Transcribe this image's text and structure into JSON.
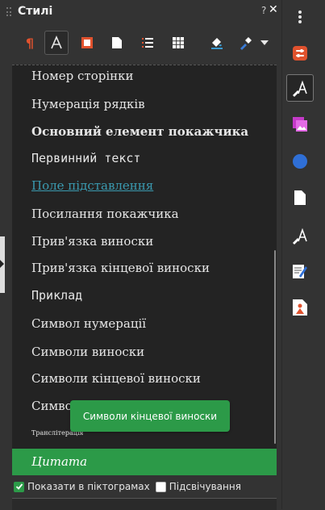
{
  "panel": {
    "title": "Стилі",
    "help_label": "?",
    "close_label": "✕"
  },
  "toolbar": {
    "buttons": [
      {
        "icon": "paragraph-styles-icon"
      },
      {
        "icon": "character-styles-icon",
        "active": true
      },
      {
        "icon": "frame-styles-icon"
      },
      {
        "icon": "page-styles-icon"
      },
      {
        "icon": "list-styles-icon"
      },
      {
        "icon": "table-styles-icon"
      },
      {
        "icon": "fill-format-mode-icon"
      },
      {
        "icon": "new-style-from-selection-icon"
      },
      {
        "icon": "styles-actions-dropdown-icon"
      }
    ]
  },
  "styles_list": {
    "items": [
      {
        "label": "Номер сторінки"
      },
      {
        "label": "Нумерація рядків"
      },
      {
        "label": "Основний елемент покажчика"
      },
      {
        "label": "Первинний текст"
      },
      {
        "label": "Поле підставлення"
      },
      {
        "label": "Посилання покажчика"
      },
      {
        "label": "Прив'язка виноски"
      },
      {
        "label": "Прив'язка кінцевої виноски"
      },
      {
        "label": "Приклад"
      },
      {
        "label": "Символ нумерації"
      },
      {
        "label": "Символи виноски"
      },
      {
        "label": "Символи кінцевої виноски"
      },
      {
        "label": "Символи рубі"
      },
      {
        "label": "Транслітерація"
      }
    ],
    "selected": {
      "label": "Цитата"
    }
  },
  "tooltip": {
    "text": "Символи кінцевої виноски"
  },
  "footer": {
    "show_previews": {
      "label": "Показати в піктограмах",
      "checked": true
    },
    "spotlight": {
      "label": "Підсвічування",
      "checked": false
    }
  },
  "deck": {
    "items": [
      {
        "icon": "menu-icon"
      },
      {
        "icon": "properties-icon"
      },
      {
        "icon": "styles-icon",
        "active": true
      },
      {
        "icon": "gallery-icon"
      },
      {
        "icon": "navigator-icon"
      },
      {
        "icon": "page-icon"
      },
      {
        "icon": "style-inspector-icon"
      },
      {
        "icon": "manage-changes-icon"
      },
      {
        "icon": "design-icon"
      }
    ]
  },
  "colors": {
    "selection": "#2c9a48",
    "panel_bg": "#333333",
    "list_bg": "#232323"
  }
}
